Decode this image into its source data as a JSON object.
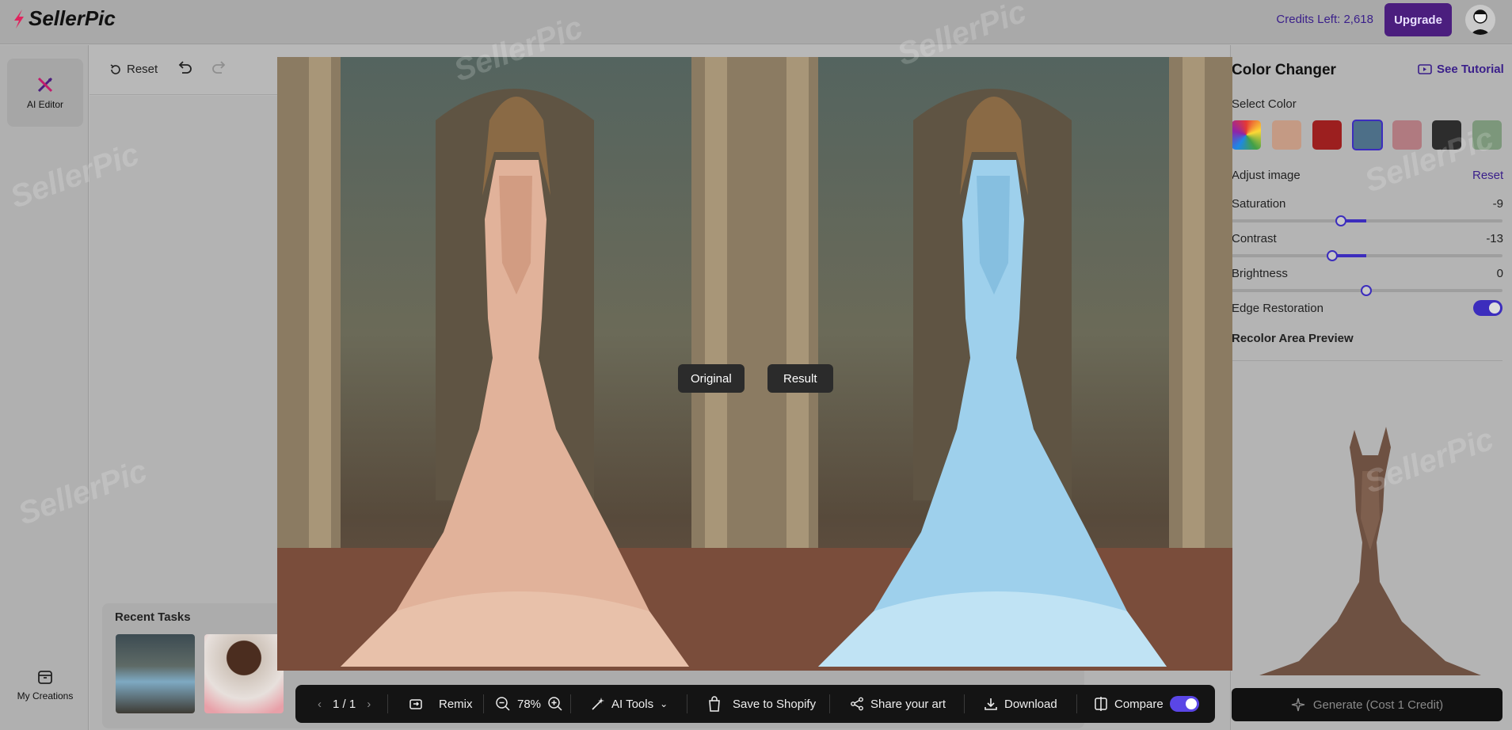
{
  "header": {
    "logo_text": "SellerPic",
    "credits_label": "Credits Left: 2,618",
    "upgrade_label": "Upgrade"
  },
  "sidebar": {
    "items": [
      {
        "label": "AI Editor",
        "icon": "ai-editor-icon"
      },
      {
        "label": "My Creations",
        "icon": "creations-icon"
      }
    ]
  },
  "toolbar": {
    "reset_label": "Reset"
  },
  "recent_tasks": {
    "title": "Recent Tasks"
  },
  "compare": {
    "original_label": "Original",
    "result_label": "Result"
  },
  "action_bar": {
    "pagination": "1 / 1",
    "remix_label": "Remix",
    "zoom": "78%",
    "ai_tools_label": "AI Tools",
    "save_shopify_label": "Save to Shopify",
    "share_label": "Share your art",
    "download_label": "Download",
    "compare_label": "Compare",
    "compare_on": true
  },
  "panel": {
    "title": "Color Changer",
    "tutorial_label": "See Tutorial",
    "select_color_label": "Select Color",
    "swatches": [
      {
        "name": "rainbow",
        "color": "multi"
      },
      {
        "name": "peach",
        "color": "#c49a84"
      },
      {
        "name": "red",
        "color": "#9c1f1f"
      },
      {
        "name": "steel-blue",
        "color": "#4d6f88",
        "selected": true
      },
      {
        "name": "rose",
        "color": "#b07a80"
      },
      {
        "name": "charcoal",
        "color": "#2d2d2d"
      },
      {
        "name": "sage",
        "color": "#7c977b"
      }
    ],
    "adjust_label": "Adjust image",
    "adjust_reset_label": "Reset",
    "sliders": [
      {
        "label": "Saturation",
        "value": "-9",
        "level": -9
      },
      {
        "label": "Contrast",
        "value": "-13",
        "level": -13
      },
      {
        "label": "Brightness",
        "value": "0",
        "level": 0
      }
    ],
    "edge_label": "Edge Restoration",
    "edge_on": true,
    "recolor_label": "Recolor Area Preview",
    "generate_label": "Generate (Cost 1 Credit)"
  },
  "colors": {
    "accent": "#3c2dbd",
    "upgrade_bg": "#4b1e7e"
  }
}
